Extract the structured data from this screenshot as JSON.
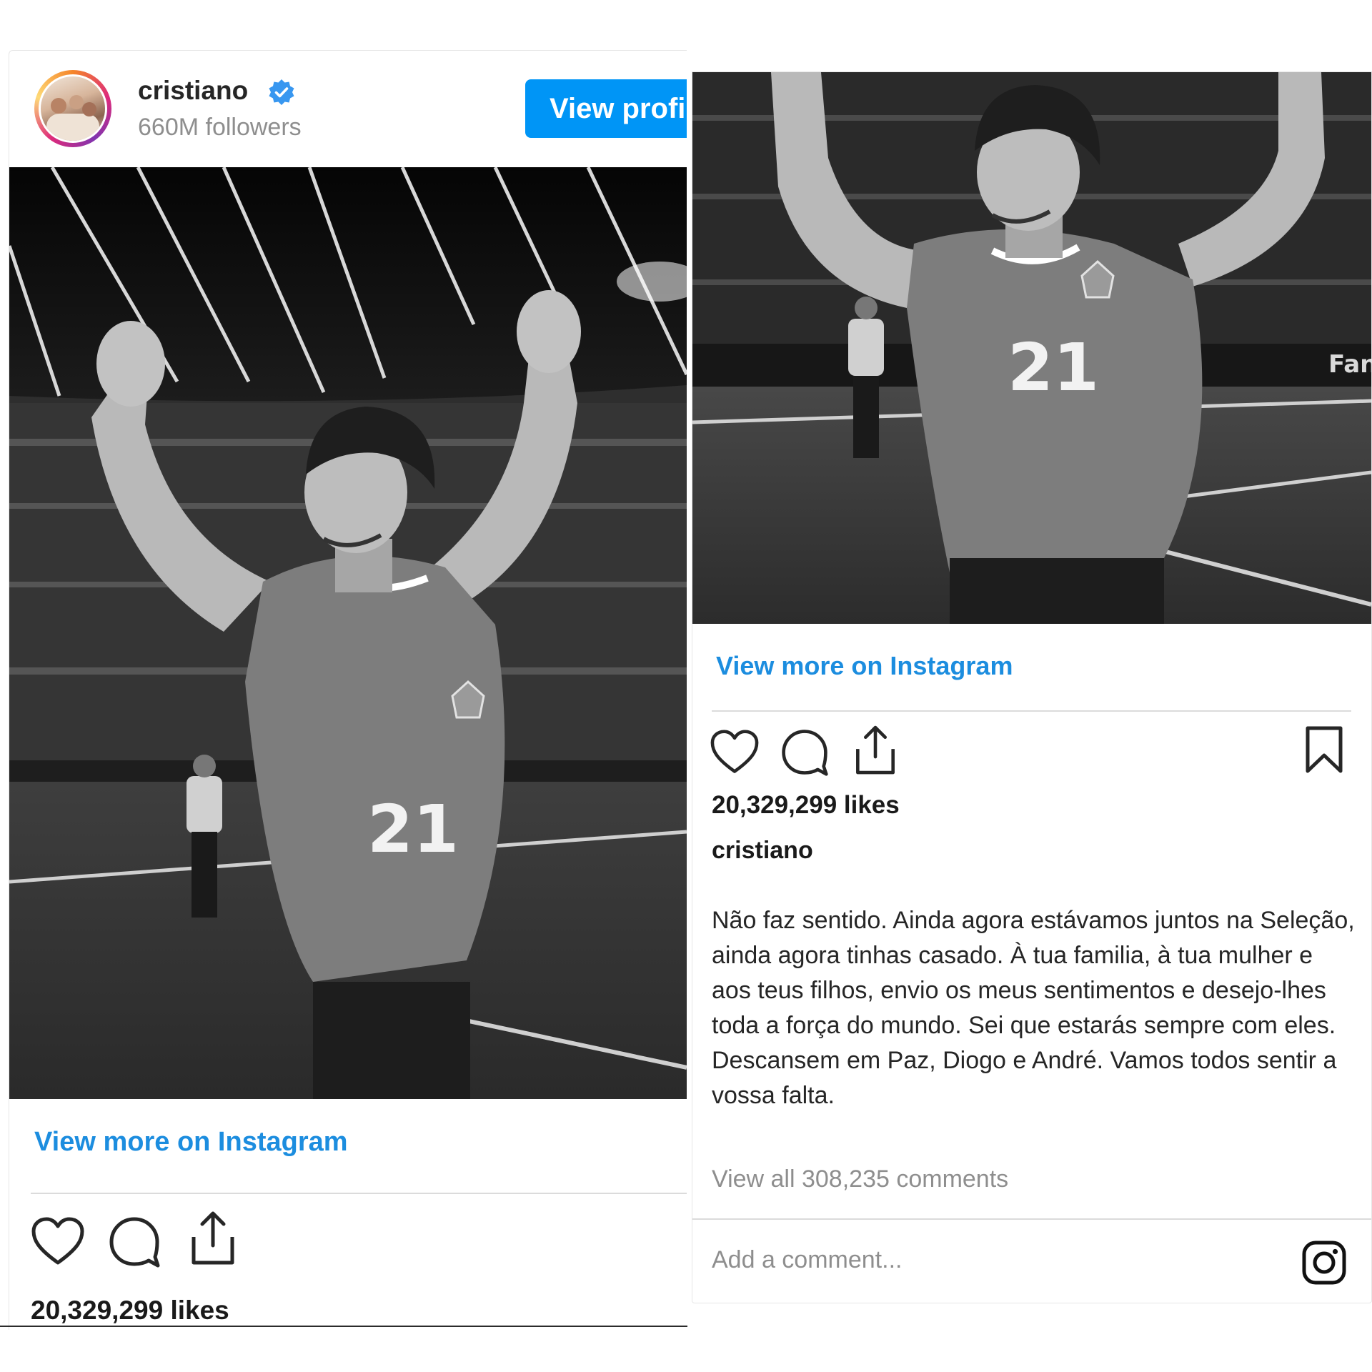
{
  "left_post": {
    "username": "cristiano",
    "followers": "660M followers",
    "view_profile_label": "View profi",
    "view_more_label": "View more on Instagram",
    "likes": "20,329,299 likes",
    "jersey_number": "21"
  },
  "right_post": {
    "view_more_label": "View more on Instagram",
    "likes": "20,329,299 likes",
    "caption_username": "cristiano",
    "caption_text": "Não faz sentido. Ainda agora estávamos juntos na Seleção, ainda agora tinhas casado. À tua familia, à tua mulher e aos teus filhos, envio os meus sentimentos e desejo-lhes toda a força do mundo. Sei que estarás sempre com eles. Descansem em Paz, Diogo e André. Vamos todos sentir a vossa falta.",
    "comments_label": "View all 308,235 comments",
    "comment_placeholder": "Add a comment...",
    "jersey_number": "21"
  },
  "icons": {
    "verified": "verified-badge-icon",
    "like": "heart-icon",
    "comment": "comment-bubble-icon",
    "share": "share-icon",
    "save": "bookmark-icon",
    "instagram": "instagram-logo-icon"
  },
  "colors": {
    "link_blue": "#1c8ddf",
    "button_blue": "#0095f6",
    "secondary_text": "#8e8e8e"
  }
}
